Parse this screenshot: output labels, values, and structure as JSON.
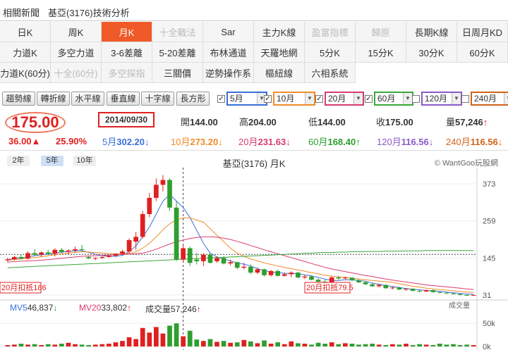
{
  "topbar": {
    "news": "相關新聞",
    "title": "基亞(3176)技術分析"
  },
  "period_grid": [
    [
      {
        "label": "日K",
        "state": "normal"
      },
      {
        "label": "周K",
        "state": "normal"
      },
      {
        "label": "月K",
        "state": "active"
      },
      {
        "label": "十全戰法",
        "state": "disabled"
      },
      {
        "label": "Sar",
        "state": "normal"
      },
      {
        "label": "主力K線",
        "state": "normal"
      },
      {
        "label": "盈富指標",
        "state": "disabled"
      },
      {
        "label": "歸原",
        "state": "disabled"
      },
      {
        "label": "長期K線",
        "state": "normal"
      },
      {
        "label": "日周月KD",
        "state": "normal"
      }
    ],
    [
      {
        "label": "力道K",
        "state": "normal"
      },
      {
        "label": "多空力道",
        "state": "normal"
      },
      {
        "label": "3-6差離",
        "state": "normal"
      },
      {
        "label": "5-20差離",
        "state": "normal"
      },
      {
        "label": "布林通道",
        "state": "normal"
      },
      {
        "label": "天羅地網",
        "state": "normal"
      },
      {
        "label": "5分K",
        "state": "normal"
      },
      {
        "label": "15分K",
        "state": "normal"
      },
      {
        "label": "30分K",
        "state": "normal"
      },
      {
        "label": "60分K",
        "state": "normal"
      }
    ],
    [
      {
        "label": "力道K(60分)",
        "state": "normal"
      },
      {
        "label": "十全(60分)",
        "state": "disabled"
      },
      {
        "label": "多空探指",
        "state": "disabled"
      },
      {
        "label": "三關價",
        "state": "normal"
      },
      {
        "label": "逆勢操作系",
        "state": "normal"
      },
      {
        "label": "樞紐線",
        "state": "normal"
      },
      {
        "label": "六相系統",
        "state": "normal"
      }
    ]
  ],
  "toolbar": {
    "buttons": [
      "趨勢線",
      "轉折線",
      "水平線",
      "垂直線",
      "十字線",
      "長方形"
    ],
    "ma_options": [
      {
        "label": "5月",
        "checked": true,
        "color": "#3a6fd8"
      },
      {
        "label": "10月",
        "checked": true,
        "color": "#f08c28"
      },
      {
        "label": "20月",
        "checked": true,
        "color": "#d83c6e"
      },
      {
        "label": "60月",
        "checked": true,
        "color": "#3aa83a"
      },
      {
        "label": "120月",
        "checked": false,
        "color": "#8a5ac8"
      },
      {
        "label": "240月",
        "checked": false,
        "color": "#d06418"
      }
    ]
  },
  "quote": {
    "price": "175.00",
    "change": "36.00▲",
    "change_pct": "25.90%",
    "date": "2014/09/30",
    "open_label": "開",
    "open": "144.00",
    "high_label": "高",
    "high": "204.00",
    "low_label": "低",
    "low": "144.00",
    "close_label": "收",
    "close": "175.00",
    "volume_label": "量",
    "volume": "57,246",
    "volume_arrow": "↑",
    "colors": {
      "up": "#e02020",
      "down": "#2e9e2e"
    }
  },
  "ma_values": [
    {
      "label": "5月",
      "value": "302.20",
      "arrow": "↓",
      "color": "#3a6fd8"
    },
    {
      "label": "10月",
      "value": "273.20",
      "arrow": "↓",
      "color": "#f08c28"
    },
    {
      "label": "20月",
      "value": "231.63",
      "arrow": "↓",
      "color": "#d83c6e"
    },
    {
      "label": "60月",
      "value": "168.40",
      "arrow": "↑",
      "color": "#2e9e2e"
    },
    {
      "label": "120月",
      "value": "116.56",
      "arrow": "↓",
      "color": "#8a5ac8"
    },
    {
      "label": "240月",
      "value": "116.56",
      "arrow": "↓",
      "color": "#d06418"
    }
  ],
  "chart_header": {
    "ranges": [
      "2年",
      "5年",
      "10年"
    ],
    "selected_range": "5年",
    "title": "基亞(3176) 月K",
    "credit": "© WantGoo玩股網"
  },
  "chart_data": {
    "type": "candlestick",
    "y_ticks": [
      373,
      259,
      145,
      31
    ],
    "ylim": [
      20,
      410
    ],
    "current_price_line": 156,
    "annotations": {
      "left": "20月扣抵186",
      "right": "20月扣抵79.5"
    },
    "candles": [
      [
        138,
        145,
        132,
        141
      ],
      [
        141,
        152,
        138,
        148
      ],
      [
        148,
        155,
        140,
        143
      ],
      [
        143,
        165,
        140,
        160
      ],
      [
        160,
        172,
        150,
        155
      ],
      [
        155,
        165,
        148,
        162
      ],
      [
        162,
        170,
        155,
        158
      ],
      [
        158,
        175,
        150,
        170
      ],
      [
        170,
        176,
        160,
        164
      ],
      [
        164,
        172,
        156,
        168
      ],
      [
        168,
        180,
        162,
        172
      ],
      [
        172,
        185,
        165,
        170
      ],
      [
        148,
        150,
        142,
        144
      ],
      [
        144,
        147,
        138,
        145
      ],
      [
        145,
        150,
        142,
        148
      ],
      [
        148,
        154,
        146,
        152
      ],
      [
        152,
        160,
        148,
        158
      ],
      [
        158,
        170,
        154,
        165
      ],
      [
        165,
        205,
        160,
        200
      ],
      [
        195,
        225,
        170,
        210
      ],
      [
        210,
        290,
        205,
        280
      ],
      [
        280,
        345,
        270,
        330
      ],
      [
        330,
        390,
        320,
        370
      ],
      [
        370,
        400,
        350,
        385
      ],
      [
        385,
        390,
        290,
        300
      ],
      [
        300,
        320,
        135,
        140
      ],
      [
        140,
        185,
        130,
        175
      ],
      [
        175,
        180,
        120,
        130
      ],
      [
        140,
        160,
        125,
        135
      ],
      [
        135,
        160,
        120,
        155
      ],
      [
        155,
        160,
        128,
        130
      ],
      [
        135,
        150,
        130,
        145
      ],
      [
        145,
        150,
        125,
        128
      ],
      [
        128,
        140,
        122,
        132
      ],
      [
        132,
        134,
        110,
        115
      ],
      [
        115,
        130,
        110,
        118
      ],
      [
        118,
        125,
        95,
        100
      ],
      [
        100,
        115,
        95,
        110
      ],
      [
        110,
        112,
        88,
        92
      ],
      [
        92,
        108,
        88,
        105
      ],
      [
        105,
        108,
        88,
        90
      ],
      [
        90,
        100,
        88,
        95
      ],
      [
        95,
        104,
        86,
        100
      ],
      [
        100,
        102,
        82,
        85
      ],
      [
        85,
        92,
        80,
        88
      ],
      [
        88,
        92,
        76,
        78
      ],
      [
        78,
        82,
        70,
        72
      ],
      [
        72,
        78,
        64,
        66
      ],
      [
        66,
        90,
        64,
        85
      ],
      [
        85,
        90,
        78,
        82
      ],
      [
        82,
        88,
        80,
        84
      ],
      [
        84,
        86,
        74,
        76
      ],
      [
        76,
        80,
        68,
        70
      ],
      [
        70,
        74,
        62,
        64
      ],
      [
        64,
        68,
        56,
        58
      ],
      [
        58,
        66,
        54,
        62
      ],
      [
        62,
        64,
        50,
        52
      ],
      [
        52,
        58,
        48,
        54
      ],
      [
        54,
        56,
        46,
        48
      ],
      [
        48,
        52,
        44,
        50
      ],
      [
        50,
        52,
        42,
        44
      ],
      [
        44,
        46,
        40,
        42
      ],
      [
        42,
        48,
        40,
        46
      ],
      [
        46,
        48,
        38,
        40
      ],
      [
        40,
        42,
        36,
        38
      ],
      [
        38,
        40,
        34,
        36
      ],
      [
        36,
        38,
        32,
        34
      ],
      [
        34,
        35,
        30,
        31
      ],
      [
        31,
        33,
        29,
        30
      ],
      [
        30,
        32,
        28,
        31
      ]
    ],
    "ma_series": [
      {
        "name": "5月",
        "color": "#3a6fd8",
        "values": [
          140,
          143,
          145,
          148,
          152,
          155,
          157,
          160,
          163,
          165,
          167,
          168,
          162,
          157,
          152,
          150,
          150,
          153,
          165,
          182,
          210,
          240,
          280,
          320,
          340,
          320,
          300,
          270,
          230,
          190,
          160,
          148,
          142,
          136,
          130,
          126,
          120,
          112,
          106,
          102,
          100,
          98,
          97,
          96,
          93,
          90,
          85,
          80,
          76,
          76,
          78,
          78,
          76,
          73,
          68,
          64,
          60,
          57,
          54,
          51,
          49,
          47,
          45,
          44,
          42,
          40,
          38,
          36,
          34,
          33
        ]
      },
      {
        "name": "10月",
        "color": "#f08c28",
        "values": [
          138,
          140,
          142,
          144,
          146,
          149,
          152,
          155,
          158,
          160,
          162,
          164,
          163,
          162,
          160,
          158,
          157,
          157,
          159,
          164,
          175,
          190,
          210,
          232,
          250,
          262,
          268,
          268,
          262,
          255,
          235,
          215,
          195,
          175,
          160,
          150,
          142,
          136,
          130,
          125,
          120,
          116,
          112,
          108,
          104,
          100,
          96,
          92,
          89,
          87,
          85,
          83,
          80,
          78,
          76,
          74,
          72,
          70,
          66,
          62,
          58,
          55,
          52,
          50,
          48,
          46,
          44,
          42,
          40,
          39
        ]
      },
      {
        "name": "20月",
        "color": "#d83c6e",
        "values": [
          132,
          134,
          135,
          136,
          137,
          138,
          140,
          142,
          144,
          146,
          148,
          150,
          151,
          152,
          153,
          154,
          155,
          156,
          157,
          158,
          160,
          165,
          172,
          180,
          188,
          195,
          200,
          205,
          208,
          210,
          210,
          209,
          206,
          202,
          196,
          190,
          183,
          177,
          170,
          164,
          158,
          152,
          146,
          140,
          134,
          128,
          122,
          116,
          111,
          107,
          103,
          99,
          95,
          91,
          88,
          84,
          80,
          77,
          74,
          71,
          68,
          65,
          62,
          60,
          58,
          56,
          54,
          52,
          50,
          48
        ]
      },
      {
        "name": "60月",
        "color": "#3aa83a",
        "values": [
          115,
          116,
          117,
          118,
          119,
          120,
          121,
          122,
          123,
          124,
          125,
          126,
          127,
          128,
          129,
          130,
          131,
          132,
          133,
          134,
          135,
          136,
          137,
          138,
          139,
          140,
          141,
          142,
          143,
          144,
          145,
          146,
          147,
          148,
          149,
          150,
          151,
          152,
          153,
          154,
          155,
          156,
          157,
          158,
          159,
          160,
          161,
          162,
          162,
          163,
          163,
          164,
          164,
          165,
          165,
          165,
          166,
          166,
          166,
          167,
          167,
          167,
          168,
          168,
          168,
          168,
          168,
          168,
          168,
          168
        ]
      }
    ],
    "volume": {
      "label_mv5": "MV5",
      "mv5": "46,837",
      "mv5_arrow": "↓",
      "label_mv20": "MV20",
      "mv20": "33,802",
      "mv20_arrow": "↑",
      "label_vol": "成交量",
      "vol": "57,246",
      "vol_arrow": "↑",
      "axis_title": "成交量",
      "y_ticks": [
        "50k",
        "0k"
      ],
      "ylim": [
        0,
        70000
      ],
      "values": [
        3000,
        4000,
        6000,
        4000,
        5000,
        3000,
        5000,
        4000,
        6000,
        8000,
        5000,
        4000,
        3000,
        4000,
        5000,
        6000,
        9000,
        12000,
        20000,
        16000,
        40000,
        30000,
        42000,
        28000,
        45000,
        50000,
        22000,
        34000,
        15000,
        12000,
        16000,
        10000,
        12000,
        8000,
        9000,
        14000,
        11000,
        7000,
        13000,
        6000,
        9000,
        5000,
        11000,
        7000,
        6000,
        4000,
        8000,
        6000,
        9000,
        5000,
        7000,
        6000,
        4000,
        5000,
        6000,
        4000,
        3000,
        5000,
        4000,
        6000,
        3000,
        5000,
        4000,
        3000,
        6000,
        4000,
        5000,
        3000,
        4000,
        3000
      ]
    }
  }
}
